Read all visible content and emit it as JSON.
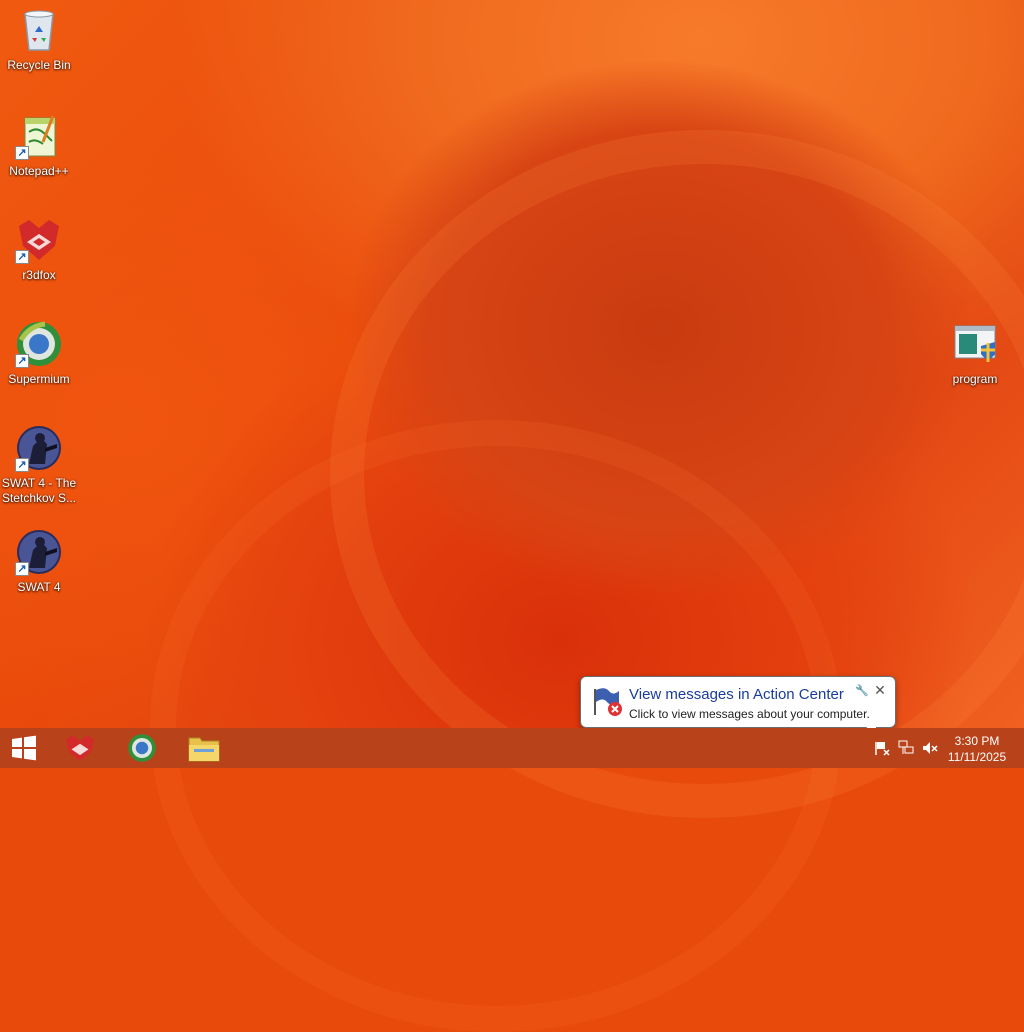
{
  "desktop": {
    "icons": [
      {
        "label": "Recycle Bin",
        "icon": "recycle-bin-icon"
      },
      {
        "label": "Notepad++",
        "icon": "notepad-plus-plus-icon"
      },
      {
        "label": "r3dfox",
        "icon": "r3dfox-icon"
      },
      {
        "label": "Supermium",
        "icon": "supermium-icon"
      },
      {
        "label": "SWAT 4 - The Stetchkov S...",
        "icon": "swat4-stetchkov-icon"
      },
      {
        "label": "SWAT 4",
        "icon": "swat4-icon"
      },
      {
        "label": "program",
        "icon": "program-icon"
      }
    ]
  },
  "taskbar": {
    "start": {
      "icon": "windows-start-icon"
    },
    "pinned": [
      {
        "icon": "r3dfox-icon"
      },
      {
        "icon": "supermium-icon"
      },
      {
        "icon": "file-explorer-icon"
      }
    ],
    "tray": {
      "icons": [
        "action-center-flag-icon",
        "network-icon",
        "volume-muted-icon"
      ],
      "time": "3:30 PM",
      "date": "11/11/2025"
    }
  },
  "notification": {
    "title": "View messages in Action Center",
    "text": "Click to view messages about your computer.",
    "icon": "action-center-flag-icon"
  },
  "colors": {
    "wallpaper": "#e84a0c",
    "taskbar": "#b8431a",
    "balloon_title": "#1a3d9c"
  }
}
